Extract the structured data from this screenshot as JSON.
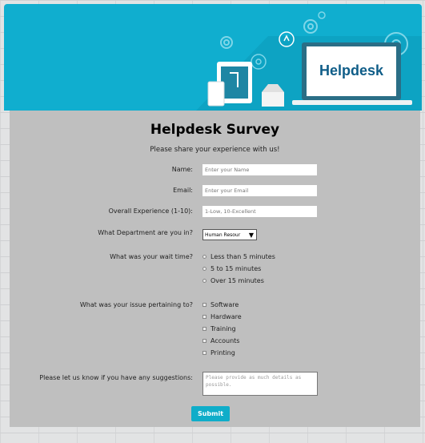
{
  "banner": {
    "logo_text": "Helpdesk"
  },
  "form": {
    "title": "Helpdesk Survey",
    "subtitle": "Please share your experience with us!",
    "name": {
      "label": "Name:",
      "placeholder": "Enter your Name"
    },
    "email": {
      "label": "Email:",
      "placeholder": "Enter your Email"
    },
    "experience": {
      "label": "Overall Experience (1-10):",
      "placeholder": "1-Low, 10-Excellent"
    },
    "department": {
      "label": "What Department are you in?",
      "selected": "Human Resour",
      "arrow": "▼"
    },
    "wait_time": {
      "label": "What was your wait time?",
      "options": [
        "Less than 5 minutes",
        "5 to 15 minutes",
        "Over 15 minutes"
      ]
    },
    "issue": {
      "label": "What was your issue pertaining to?",
      "options": [
        "Software",
        "Hardware",
        "Training",
        "Accounts",
        "Printing"
      ]
    },
    "suggestions": {
      "label": "Please let us know if you have any suggestions:",
      "placeholder": "Please provide as much details as possible."
    },
    "submit_label": "Submit"
  }
}
